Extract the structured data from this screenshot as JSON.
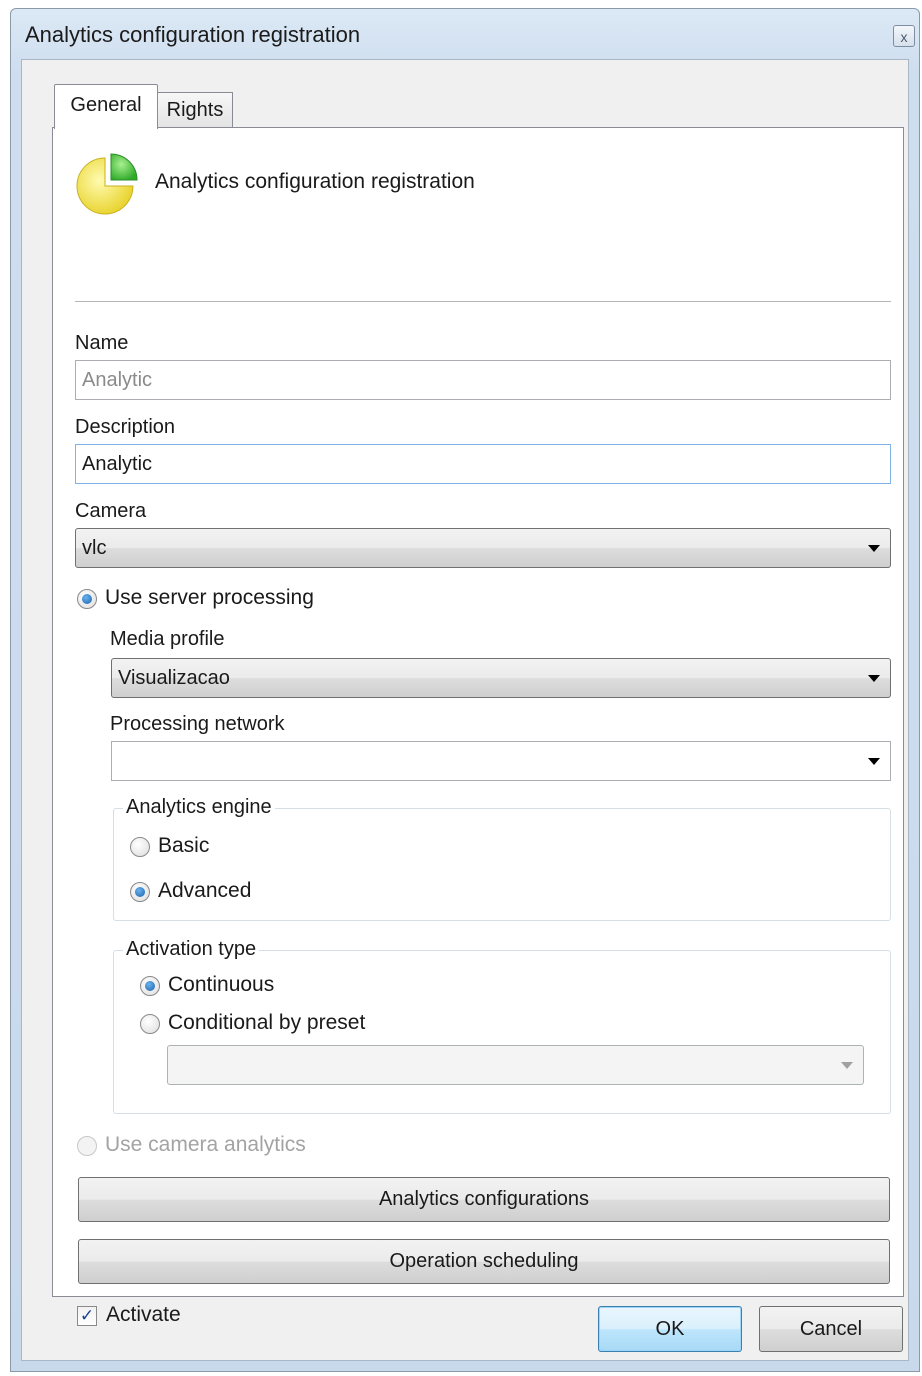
{
  "window": {
    "title": "Analytics configuration registration",
    "close_glyph": "x"
  },
  "tabs": [
    {
      "label": "General",
      "selected": true
    },
    {
      "label": "Rights",
      "selected": false
    }
  ],
  "header": {
    "icon": "pie-chart-icon",
    "text": "Analytics configuration registration"
  },
  "form": {
    "name": {
      "label": "Name",
      "value": "Analytic"
    },
    "description": {
      "label": "Description",
      "value": "Analytic"
    },
    "camera": {
      "label": "Camera",
      "value": "vlc"
    },
    "use_server_processing": {
      "label": "Use server processing",
      "checked": true
    },
    "media_profile": {
      "label": "Media profile",
      "value": "Visualizacao"
    },
    "processing_network": {
      "label": "Processing network",
      "value": ""
    },
    "analytics_engine": {
      "title": "Analytics engine",
      "options": [
        {
          "label": "Basic",
          "checked": false
        },
        {
          "label": "Advanced",
          "checked": true
        }
      ]
    },
    "activation_type": {
      "title": "Activation type",
      "options": [
        {
          "label": "Continuous",
          "checked": true
        },
        {
          "label": "Conditional by preset",
          "checked": false
        }
      ],
      "preset_value": ""
    },
    "use_camera_analytics": {
      "label": "Use camera analytics",
      "checked": false,
      "enabled": false
    },
    "analytics_configurations_button": "Analytics configurations",
    "operation_scheduling_button": "Operation scheduling",
    "activate": {
      "label": "Activate",
      "checked": true,
      "glyph": "✓"
    }
  },
  "footer": {
    "ok_label": "OK",
    "cancel_label": "Cancel"
  },
  "colors": {
    "title_bar": "#cfdeef",
    "default_button": "#bee6fd",
    "radio_dot": "#1a5fa8",
    "pie_yellow": "#f3e64a",
    "pie_green": "#3fbf3a"
  }
}
